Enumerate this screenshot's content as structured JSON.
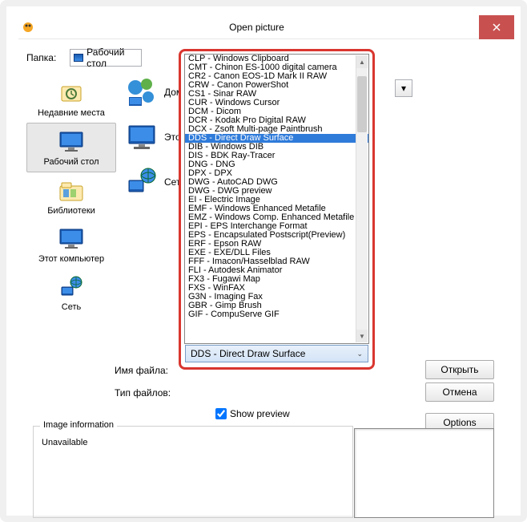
{
  "window": {
    "title": "Open picture"
  },
  "folder": {
    "label": "Папка:",
    "value": "Рабочий стол"
  },
  "sidebar": [
    {
      "name": "recent",
      "label": "Недавние места"
    },
    {
      "name": "desktop",
      "label": "Рабочий стол"
    },
    {
      "name": "libraries",
      "label": "Библиотеки"
    },
    {
      "name": "computer",
      "label": "Этот компьютер"
    },
    {
      "name": "network",
      "label": "Сеть"
    }
  ],
  "file_area": [
    {
      "label": "Дома"
    },
    {
      "label": "Этот"
    },
    {
      "label": "Сеть"
    }
  ],
  "fields": {
    "filename_label": "Имя файла:",
    "filetype_label": "Тип файлов:"
  },
  "buttons": {
    "open": "Открыть",
    "cancel": "Отмена",
    "options": "Options"
  },
  "preview_checkbox": "Show preview",
  "info": {
    "legend": "Image information",
    "text": "Unavailable"
  },
  "dropdown": {
    "selected_value": "DDS - Direct Draw Surface",
    "selected_index": 9,
    "items": [
      "CLP - Windows Clipboard",
      "CMT - Chinon ES-1000 digital camera",
      "CR2 - Canon EOS-1D Mark II RAW",
      "CRW - Canon PowerShot",
      "CS1 - Sinar RAW",
      "CUR - Windows Cursor",
      "DCM - Dicom",
      "DCR - Kodak Pro Digital RAW",
      "DCX - Zsoft Multi-page Paintbrush",
      "DDS - Direct Draw Surface",
      "DIB - Windows DIB",
      "DIS - BDK Ray-Tracer",
      "DNG - DNG",
      "DPX - DPX",
      "DWG - AutoCAD DWG",
      "DWG - DWG preview",
      "EI - Electric Image",
      "EMF - Windows Enhanced Metafile",
      "EMZ - Windows Comp. Enhanced Metafile",
      "EPI - EPS Interchange Format",
      "EPS - Encapsulated Postscript(Preview)",
      "ERF - Epson RAW",
      "EXE - EXE/DLL Files",
      "FFF - Imacon/Hasselblad RAW",
      "FLI - Autodesk Animator",
      "FX3 - Fugawi Map",
      "FXS - WinFAX",
      "G3N - Imaging Fax",
      "GBR - Gimp Brush",
      "GIF - CompuServe GIF"
    ]
  }
}
